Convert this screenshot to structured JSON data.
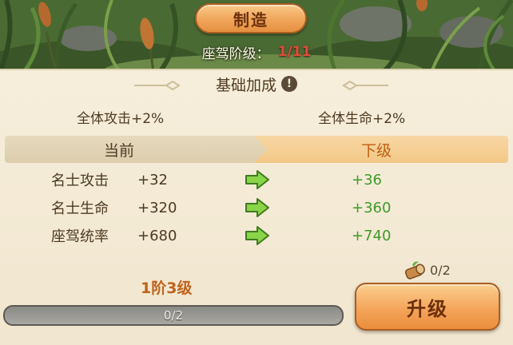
{
  "header": {
    "craft_button_label": "制造",
    "tier_label": "座驾阶级：",
    "tier_value": "1/11"
  },
  "base_bonus": {
    "title": "基础加成",
    "info_icon": "exclamation-icon",
    "left_bonus": "全体攻击+2%",
    "right_bonus": "全体生命+2%"
  },
  "compare_header": {
    "current_label": "当前",
    "next_label": "下级"
  },
  "stats": [
    {
      "label": "名士攻击",
      "current": "+32",
      "next": "+36"
    },
    {
      "label": "名士生命",
      "current": "+320",
      "next": "+360"
    },
    {
      "label": "座驾统率",
      "current": "+680",
      "next": "+740"
    }
  ],
  "material": {
    "icon": "wood-log-icon",
    "count": "0/2"
  },
  "level": {
    "text": "1阶3级",
    "progress_text": "0/2",
    "progress_fraction": 0
  },
  "upgrade_button_label": "升级",
  "colors": {
    "next_value_green": "#3f9a2c",
    "tier_value_red": "#e24a3a",
    "button_orange": "#f0a55a",
    "level_orange": "#c0621a"
  }
}
